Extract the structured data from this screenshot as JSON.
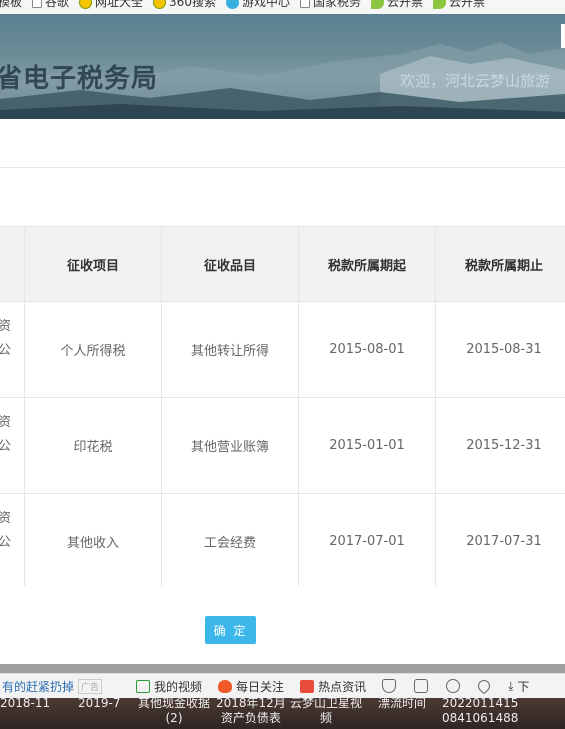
{
  "bookmarks": [
    {
      "icon": "page-icon",
      "label": "模板"
    },
    {
      "icon": "page-icon",
      "label": "谷歌"
    },
    {
      "icon": "plus-icon",
      "label": "网址大全"
    },
    {
      "icon": "plus-icon",
      "label": "360搜索"
    },
    {
      "icon": "game-icon",
      "label": "游戏中心"
    },
    {
      "icon": "page-icon",
      "label": "国家税务"
    },
    {
      "icon": "leaf-icon",
      "label": "云开票"
    },
    {
      "icon": "leaf-icon",
      "label": "云开票"
    }
  ],
  "banner": {
    "title": "省电子税务局",
    "welcome": "欢迎，河北云梦山旅游"
  },
  "table": {
    "headers": [
      "征收项目",
      "征收品目",
      "税款所属期起",
      "税款所属期止"
    ],
    "cut_col": [
      "资",
      "公"
    ],
    "rows": [
      [
        "个人所得税",
        "其他转让所得",
        "2015-08-01",
        "2015-08-31"
      ],
      [
        "印花税",
        "其他营业账簿",
        "2015-01-01",
        "2015-12-31"
      ],
      [
        "其他收入",
        "工会经费",
        "2017-07-01",
        "2017-07-31"
      ]
    ]
  },
  "confirm_label": "确 定",
  "status_bar": {
    "news": "有的赶紧扔掉",
    "ad": "广告",
    "items": [
      "我的视频",
      "每日关注",
      "热点资讯"
    ],
    "download": "下"
  },
  "taskbar": [
    {
      "line1": "2018-11",
      "line2": ""
    },
    {
      "line1": "2019-7",
      "line2": ""
    },
    {
      "line1": "其他现金收据",
      "line2": "(2)"
    },
    {
      "line1": "2018年12月",
      "line2": "资产负债表"
    },
    {
      "line1": "云梦山卫星视",
      "line2": "频"
    },
    {
      "line1": "漂流时间",
      "line2": ""
    },
    {
      "line1": "2022011415",
      "line2": "0841061488"
    }
  ],
  "colors": {
    "accent": "#3cb7ea",
    "header_bg": "#f2f2f2"
  }
}
